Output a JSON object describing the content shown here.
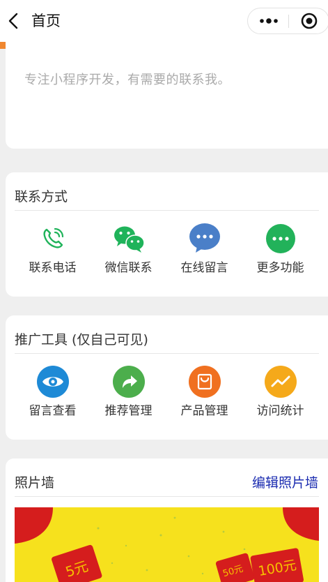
{
  "navbar": {
    "title": "首页",
    "back_icon": "chevron-left-icon",
    "more_icon": "more-dots-icon",
    "close_icon": "target-close-icon"
  },
  "intro": {
    "text": "专注小程序开发，有需要的联系我。"
  },
  "contact": {
    "title": "联系方式",
    "items": [
      {
        "label": "联系电话",
        "icon": "phone-icon",
        "color": "#1fb35a"
      },
      {
        "label": "微信联系",
        "icon": "wechat-icon",
        "color": "#1fb35a"
      },
      {
        "label": "在线留言",
        "icon": "chat-bubble-icon",
        "color": "#4a7fc8"
      },
      {
        "label": "更多功能",
        "icon": "more-circle-icon",
        "color": "#22b25a"
      }
    ]
  },
  "promo": {
    "title": "推广工具 (仅自己可见)",
    "items": [
      {
        "label": "留言查看",
        "icon": "eye-icon",
        "color": "#1e8ad6"
      },
      {
        "label": "推荐管理",
        "icon": "share-arrow-icon",
        "color": "#4cae4c"
      },
      {
        "label": "产品管理",
        "icon": "shopping-bag-icon",
        "color": "#f07020"
      },
      {
        "label": "访问统计",
        "icon": "trend-line-icon",
        "color": "#f5a91a"
      }
    ]
  },
  "photos": {
    "title": "照片墙",
    "edit_label": "编辑照片墙",
    "banner": {
      "texts": [
        "5元",
        "50元",
        "100元"
      ]
    }
  },
  "colors": {
    "accent_orange": "#f0872f",
    "link_blue": "#1a2bb0",
    "banner_yellow": "#f6e11d",
    "banner_red": "#d51d1d"
  }
}
